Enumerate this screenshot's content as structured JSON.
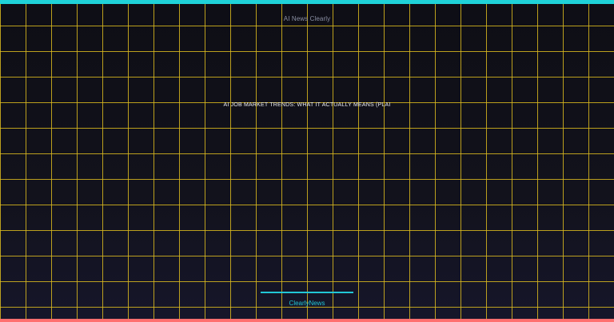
{
  "header": {
    "brand": "AI News Clearly"
  },
  "main": {
    "headline": "AI JOB MARKET TRENDS: WHAT IT ACTUALLY MEANS (PLAI"
  },
  "footer": {
    "brand": "ClearlyNews"
  },
  "colors": {
    "background": "#0f0f17",
    "grid": "#d9b81e",
    "top_bar": "#1fd2d8",
    "bottom_bar": "#ff6f6f",
    "accent": "#22c7d6",
    "brand_text": "#8a8fa3",
    "headline_text": "#e8eaf2"
  }
}
